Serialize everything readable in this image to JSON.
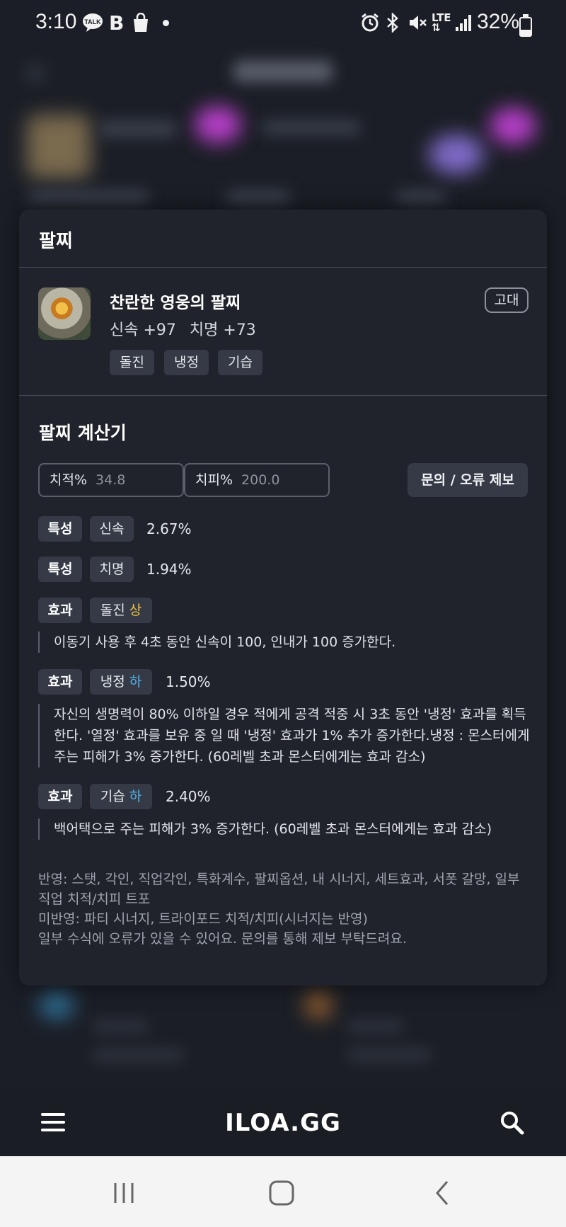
{
  "status_bar": {
    "time": "3:10",
    "left_icons": [
      "talk-icon",
      "b-icon",
      "shopping-bag-icon",
      "dot-icon"
    ],
    "right_icons": [
      "alarm-icon",
      "bluetooth-icon",
      "mute-icon",
      "lte-icon",
      "signal-icon"
    ],
    "battery_percent": "32%",
    "battery_level": 0.32
  },
  "modal": {
    "title": "팔찌",
    "item": {
      "name": "찬란한 영웅의 팔찌",
      "stats": [
        "신속 +97",
        "치명 +73"
      ],
      "grade": "고대",
      "tags": [
        "돌진",
        "냉정",
        "기습"
      ]
    },
    "calculator": {
      "title": "팔찌 계산기",
      "crit_rate": {
        "label": "치적%",
        "placeholder": "34.8"
      },
      "crit_damage": {
        "label": "치피%",
        "placeholder": "200.0"
      },
      "report_button": "문의 / 오류 제보",
      "rows": [
        {
          "key": "특성",
          "name": "신속",
          "level": "",
          "value": "2.67%",
          "description": ""
        },
        {
          "key": "특성",
          "name": "치명",
          "level": "",
          "value": "1.94%",
          "description": ""
        },
        {
          "key": "효과",
          "name": "돌진",
          "level": "상",
          "value": "",
          "description": "이동기 사용 후 4초 동안 신속이 100, 인내가 100 증가한다."
        },
        {
          "key": "효과",
          "name": "냉정",
          "level": "하",
          "value": "1.50%",
          "description": "자신의 생명력이 80% 이하일 경우 적에게 공격 적중 시 3초 동안 '냉정' 효과를 획득한다. '열정' 효과를 보유 중 일 때 '냉정' 효과가 1% 추가 증가한다.냉정 : 몬스터에게 주는 피해가 3% 증가한다. (60레벨 초과 몬스터에게는 효과 감소)"
        },
        {
          "key": "효과",
          "name": "기습",
          "level": "하",
          "value": "2.40%",
          "description": "백어택으로 주는 피해가 3% 증가한다. (60레벨 초과 몬스터에게는 효과 감소)"
        }
      ],
      "notes": [
        "반영: 스탯, 각인, 직업각인, 특화계수, 팔찌옵션, 내 시너지, 세트효과, 서폿 갈망, 일부 직업 치적/치피 트포",
        "미반영: 파티 시너지, 트라이포드 치적/치피(시너지는 반영)",
        "일부 수식에 오류가 있을 수 있어요. 문의를 통해 제보 부탁드려요."
      ]
    }
  },
  "app_nav": {
    "brand": "ILOA.GG"
  },
  "colors": {
    "level_high": "#f5c542",
    "level_low": "#4fb3e8",
    "modal_bg": "#20232c",
    "chip_bg": "#353a46"
  }
}
